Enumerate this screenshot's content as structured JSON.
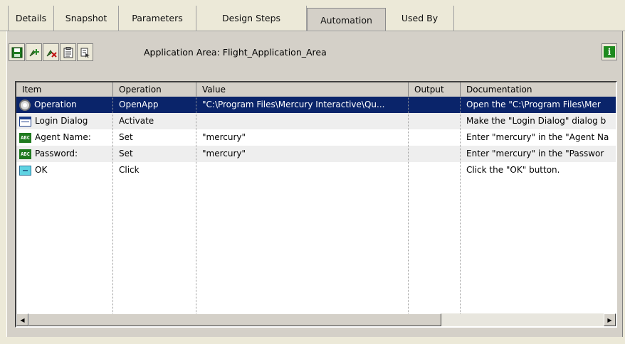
{
  "tabs": [
    {
      "label": "Details"
    },
    {
      "label": "Snapshot"
    },
    {
      "label": "Parameters"
    },
    {
      "label": "Design Steps"
    },
    {
      "label": "Automation"
    },
    {
      "label": "Used By"
    }
  ],
  "toolbar": {
    "buttons": [
      "save-icon",
      "add-step-icon",
      "delete-step-icon",
      "properties-icon",
      "view-icon"
    ],
    "application_area": "Application Area: Flight_Application_Area",
    "info_glyph": "i"
  },
  "grid": {
    "columns": [
      "Item",
      "Operation",
      "Value",
      "Output",
      "Documentation"
    ],
    "rows": [
      {
        "icon": "operation-icon",
        "item": "Operation",
        "operation": "OpenApp",
        "value": "\"C:\\Program Files\\Mercury Interactive\\Qu...",
        "output": "",
        "documentation": "Open the  \"C:\\Program Files\\Mer"
      },
      {
        "icon": "dialog-icon",
        "item": "Login Dialog",
        "operation": "Activate",
        "value": "",
        "output": "",
        "documentation": "Make the \"Login Dialog\" dialog b"
      },
      {
        "icon": "edit-field-icon",
        "item": "Agent Name:",
        "operation": "Set",
        "value": "\"mercury\"",
        "output": "",
        "documentation": "Enter \"mercury\" in the \"Agent Na"
      },
      {
        "icon": "edit-field-icon",
        "item": "Password:",
        "operation": "Set",
        "value": "\"mercury\"",
        "output": "",
        "documentation": "Enter \"mercury\" in the \"Passwor"
      },
      {
        "icon": "button-icon",
        "item": "OK",
        "operation": "Click",
        "value": "",
        "output": "",
        "documentation": "Click the \"OK\" button."
      }
    ]
  },
  "icon_text": {
    "edit_field": "ABC"
  },
  "colors": {
    "selection": "#0A246A",
    "alt_row": "#EEEEEE",
    "info": "#1e8a1e"
  }
}
